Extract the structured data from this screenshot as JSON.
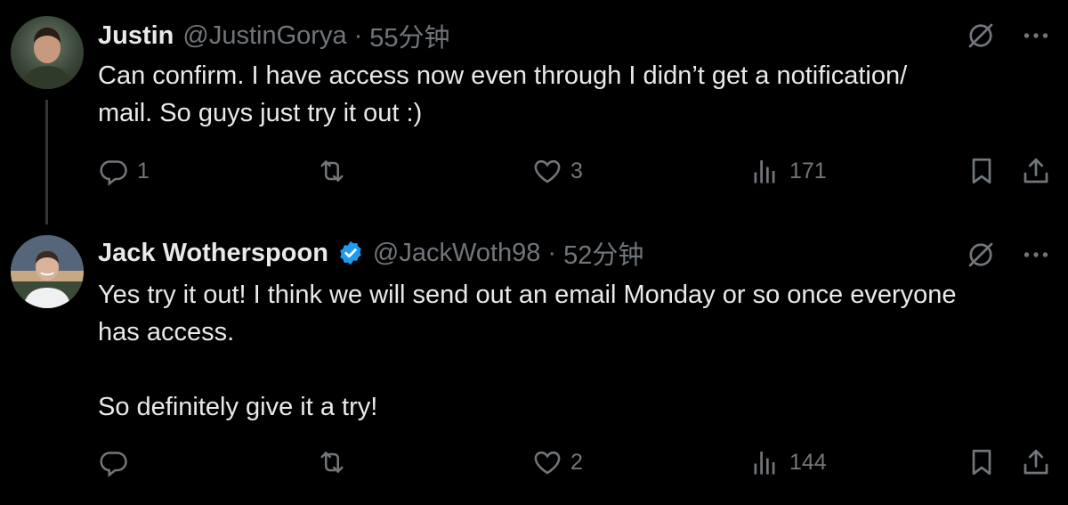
{
  "tweets": [
    {
      "name": "Justin",
      "handle": "@JustinGorya",
      "separator": "·",
      "time": "55分钟",
      "verified": false,
      "text": "Can confirm. I have access now even through I didn’t get a notification/\nmail. So guys just try it out :)",
      "actions": {
        "replies": "1",
        "retweets": "",
        "likes": "3",
        "views": "171"
      }
    },
    {
      "name": "Jack Wotherspoon",
      "handle": "@JackWoth98",
      "separator": "·",
      "time": "52分钟",
      "verified": true,
      "text": "Yes try it out! I think we will send out an email Monday or so once everyone\nhas access.\n\nSo definitely give it a try!",
      "actions": {
        "replies": "",
        "retweets": "",
        "likes": "2",
        "views": "144"
      }
    }
  ],
  "colors": {
    "background": "#000000",
    "text": "#e7e9ea",
    "muted": "#71767b",
    "verified": "#1d9bf0",
    "thread_line": "#333639"
  },
  "icons": [
    "grok-icon",
    "more-icon",
    "reply-icon",
    "retweet-icon",
    "like-icon",
    "views-icon",
    "bookmark-icon",
    "share-icon",
    "verified-badge-icon"
  ]
}
